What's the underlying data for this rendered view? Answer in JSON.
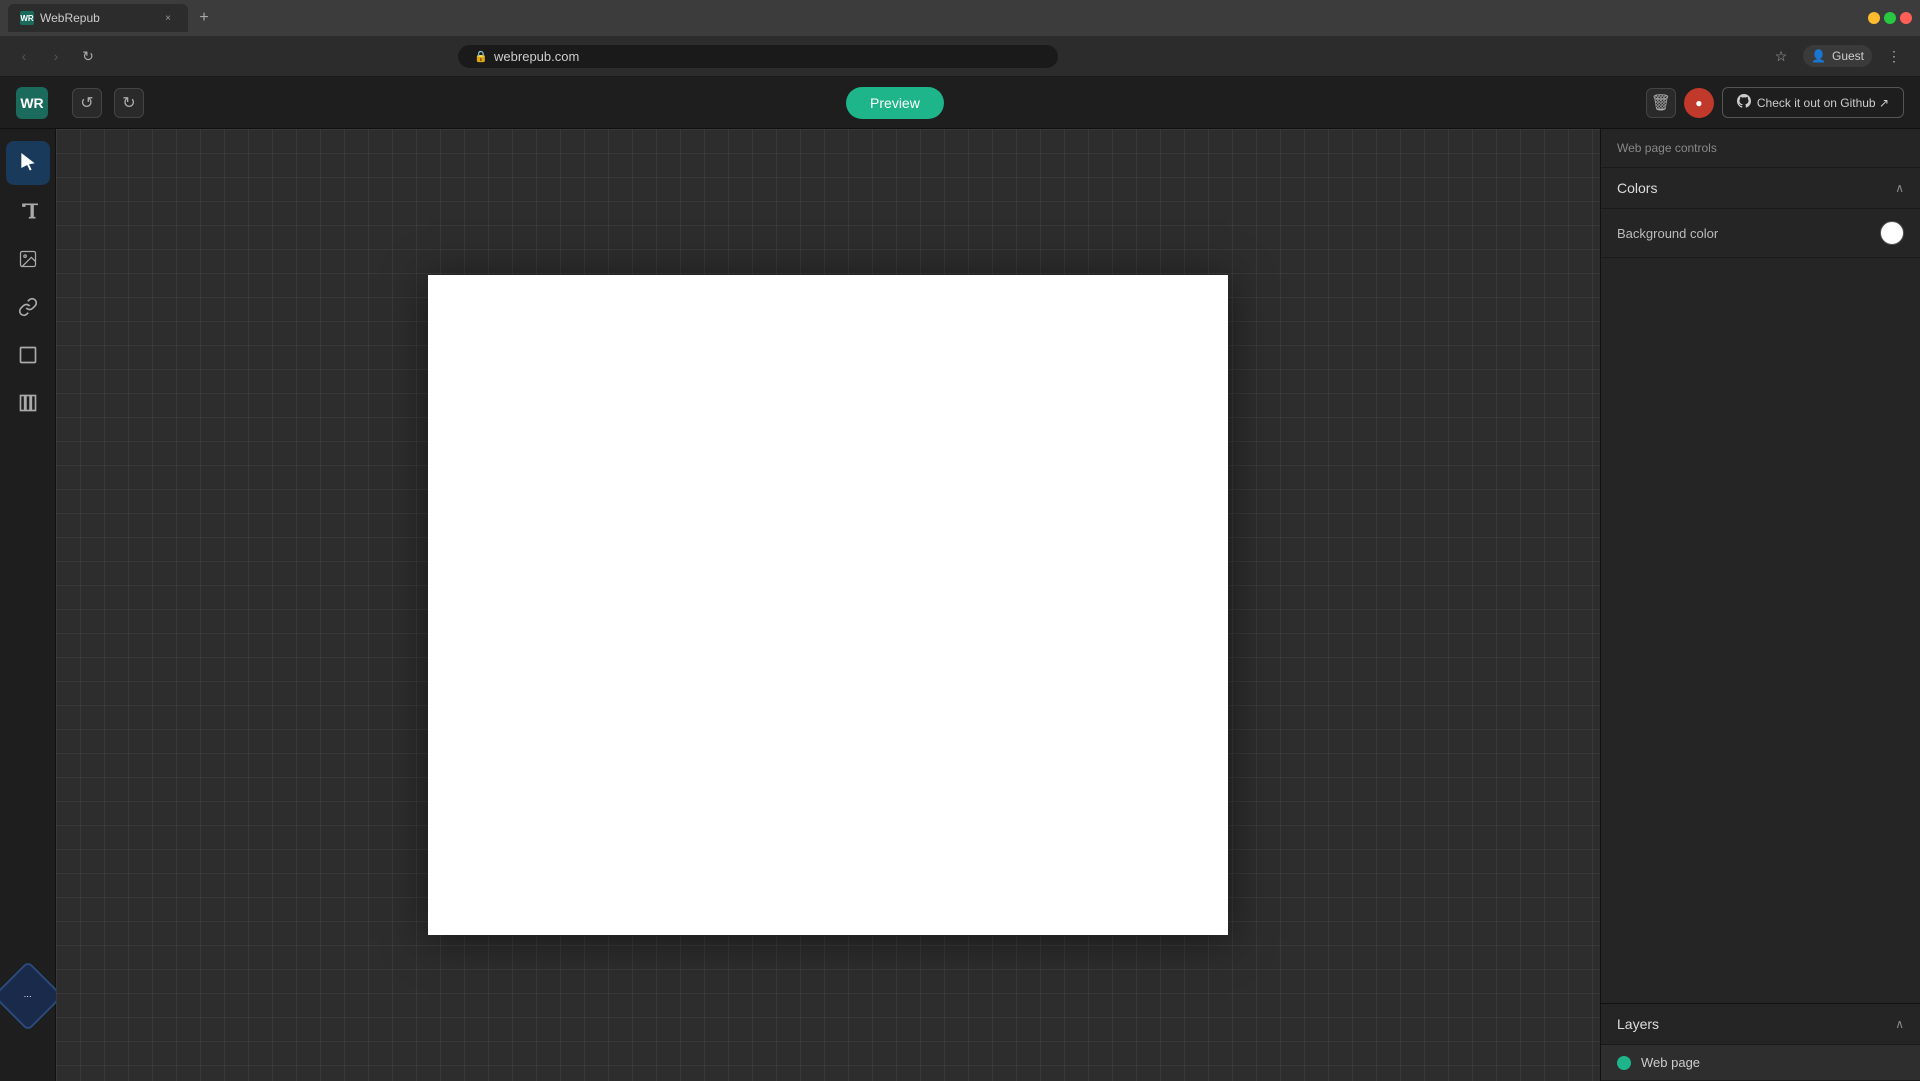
{
  "browser": {
    "tab": {
      "favicon": "WR",
      "title": "WebRepub",
      "close_label": "×"
    },
    "new_tab_label": "+",
    "window_controls": {
      "close": "close",
      "minimize": "minimize",
      "maximize": "maximize"
    },
    "nav": {
      "back": "‹",
      "forward": "›",
      "refresh": "↻",
      "url": "webrepub.com"
    },
    "profile": {
      "icon": "👤",
      "label": "Guest"
    }
  },
  "toolbar": {
    "logo": "WR",
    "logo_text": "",
    "undo_label": "↺",
    "redo_label": "↻",
    "preview_label": "Preview",
    "delete_label": "🗑",
    "settings_label": "●",
    "github_label": "Check it out on Github ↗"
  },
  "tools": [
    {
      "id": "cursor",
      "icon": "cursor",
      "label": "Cursor tool",
      "active": true
    },
    {
      "id": "text",
      "icon": "text",
      "label": "Text tool",
      "active": false
    },
    {
      "id": "image",
      "icon": "image",
      "label": "Image tool",
      "active": false
    },
    {
      "id": "link",
      "icon": "link",
      "label": "Link tool",
      "active": false
    },
    {
      "id": "rect",
      "icon": "rect",
      "label": "Rectangle tool",
      "active": false
    },
    {
      "id": "grid",
      "icon": "grid",
      "label": "Grid tool",
      "active": false
    }
  ],
  "right_panel": {
    "web_page_controls": "Web page controls",
    "colors": {
      "title": "Colors",
      "background_color_label": "Background color",
      "background_color_value": "#ffffff"
    },
    "layers": {
      "title": "Layers",
      "items": [
        {
          "id": "web-page",
          "label": "Web page",
          "visible": true
        }
      ]
    }
  },
  "canvas": {
    "background": "#ffffff"
  },
  "floating_tool": {
    "icon": "⋯"
  }
}
